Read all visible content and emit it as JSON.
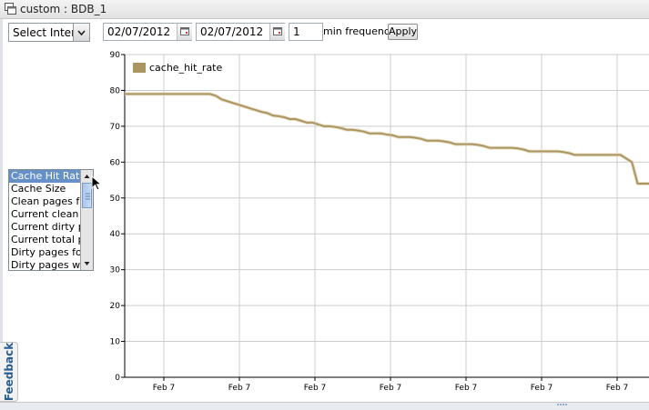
{
  "window": {
    "title": "custom : BDB_1"
  },
  "toolbar": {
    "interval_select": "Select Interval",
    "start_date": "02/07/2012",
    "end_date": "02/07/2012",
    "frequency_value": "1",
    "frequency_label": "min frequency",
    "apply_label": "Apply"
  },
  "metrics": {
    "items": [
      "Cache Hit Rate",
      "Cache Size",
      "Clean pages forced",
      "Current clean pages",
      "Current dirty pages",
      "Current total pages",
      "Dirty pages forced",
      "Dirty pages written"
    ],
    "selected_index": 0
  },
  "feedback": {
    "label": "Feedback"
  },
  "colors": {
    "series": "#ac9660",
    "grid": "#cccccc",
    "selection": "#6690c8"
  },
  "chart_data": {
    "type": "line",
    "legend": "top-left",
    "grid": true,
    "ylim": [
      0,
      90
    ],
    "y_ticks": [
      0,
      10,
      20,
      30,
      40,
      50,
      60,
      70,
      80,
      90
    ],
    "x_tick_labels": [
      "Feb 7",
      "Feb 7",
      "Feb 7",
      "Feb 7",
      "Feb 7",
      "Feb 7",
      "Feb 7"
    ],
    "series": [
      {
        "name": "cache_hit_rate",
        "values": [
          79,
          79,
          79,
          79,
          79,
          79,
          79,
          79,
          79,
          79,
          79,
          79,
          79,
          79,
          79,
          79,
          78.5,
          77.5,
          77,
          76.5,
          76,
          75.5,
          75,
          74.5,
          74,
          73.7,
          73,
          72.8,
          72.5,
          72,
          72,
          71.5,
          71,
          71,
          70.5,
          70,
          70,
          69.8,
          69.5,
          69,
          69,
          68.8,
          68.5,
          68,
          68,
          68,
          67.7,
          67.5,
          67,
          67,
          67,
          66.8,
          66.5,
          66,
          66,
          66,
          65.8,
          65.5,
          65,
          65,
          65,
          65,
          64.8,
          64.5,
          64,
          64,
          64,
          64,
          64,
          63.8,
          63.5,
          63,
          63,
          63,
          63,
          63,
          63,
          62.8,
          62.5,
          62,
          62,
          62,
          62,
          62,
          62,
          62,
          62,
          62,
          61,
          60,
          54,
          54,
          54
        ]
      }
    ]
  }
}
